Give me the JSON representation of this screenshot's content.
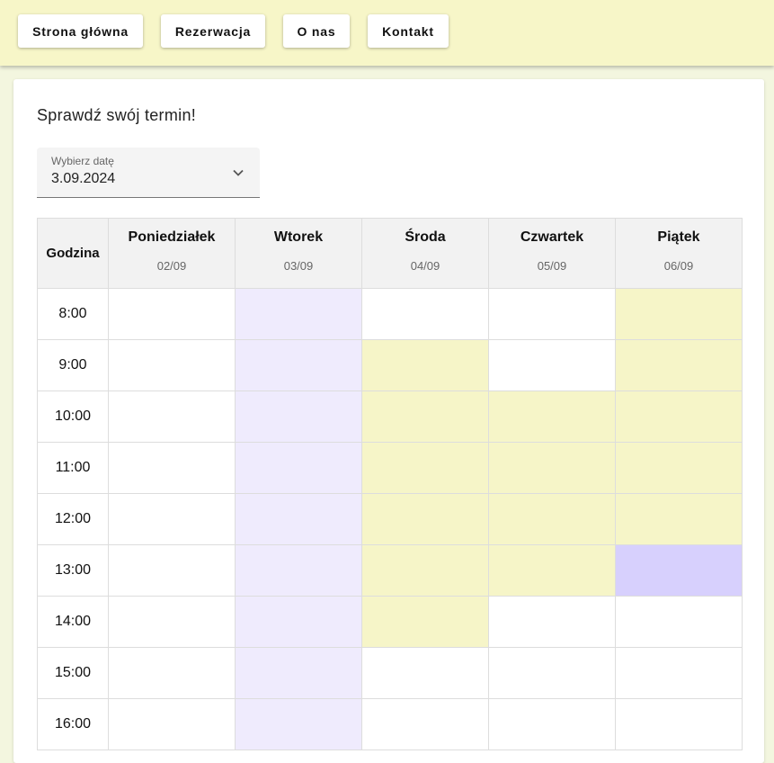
{
  "nav": {
    "items": [
      "Strona główna",
      "Rezerwacja",
      "O nas",
      "Kontakt"
    ]
  },
  "heading": "Sprawdź swój termin!",
  "date_picker": {
    "label": "Wybierz datę",
    "value": "3.09.2024"
  },
  "schedule": {
    "hour_header": "Godzina",
    "days": [
      {
        "name": "Poniedziałek",
        "date": "02/09"
      },
      {
        "name": "Wtorek",
        "date": "03/09"
      },
      {
        "name": "Środa",
        "date": "04/09"
      },
      {
        "name": "Czwartek",
        "date": "05/09"
      },
      {
        "name": "Piątek",
        "date": "06/09"
      }
    ],
    "hours": [
      "8:00",
      "9:00",
      "10:00",
      "11:00",
      "12:00",
      "13:00",
      "14:00",
      "15:00",
      "16:00"
    ],
    "cells": [
      [
        "free",
        "lav",
        "free",
        "free",
        "yel"
      ],
      [
        "free",
        "lav",
        "yel",
        "free",
        "yel"
      ],
      [
        "free",
        "lav",
        "yel",
        "yel",
        "yel"
      ],
      [
        "free",
        "lav",
        "yel",
        "yel",
        "yel"
      ],
      [
        "free",
        "lav",
        "yel",
        "yel",
        "yel"
      ],
      [
        "free",
        "lav",
        "yel",
        "yel",
        "vio"
      ],
      [
        "free",
        "lav",
        "yel",
        "free",
        "free"
      ],
      [
        "free",
        "lav",
        "free",
        "free",
        "free"
      ],
      [
        "free",
        "lav",
        "free",
        "free",
        "free"
      ]
    ]
  },
  "colors": {
    "topbar": "#f7f6c8",
    "background": "#f3f6df",
    "selected_day": "#efebfd",
    "booked": "#f6f5c8",
    "highlight": "#d7d0fd"
  }
}
